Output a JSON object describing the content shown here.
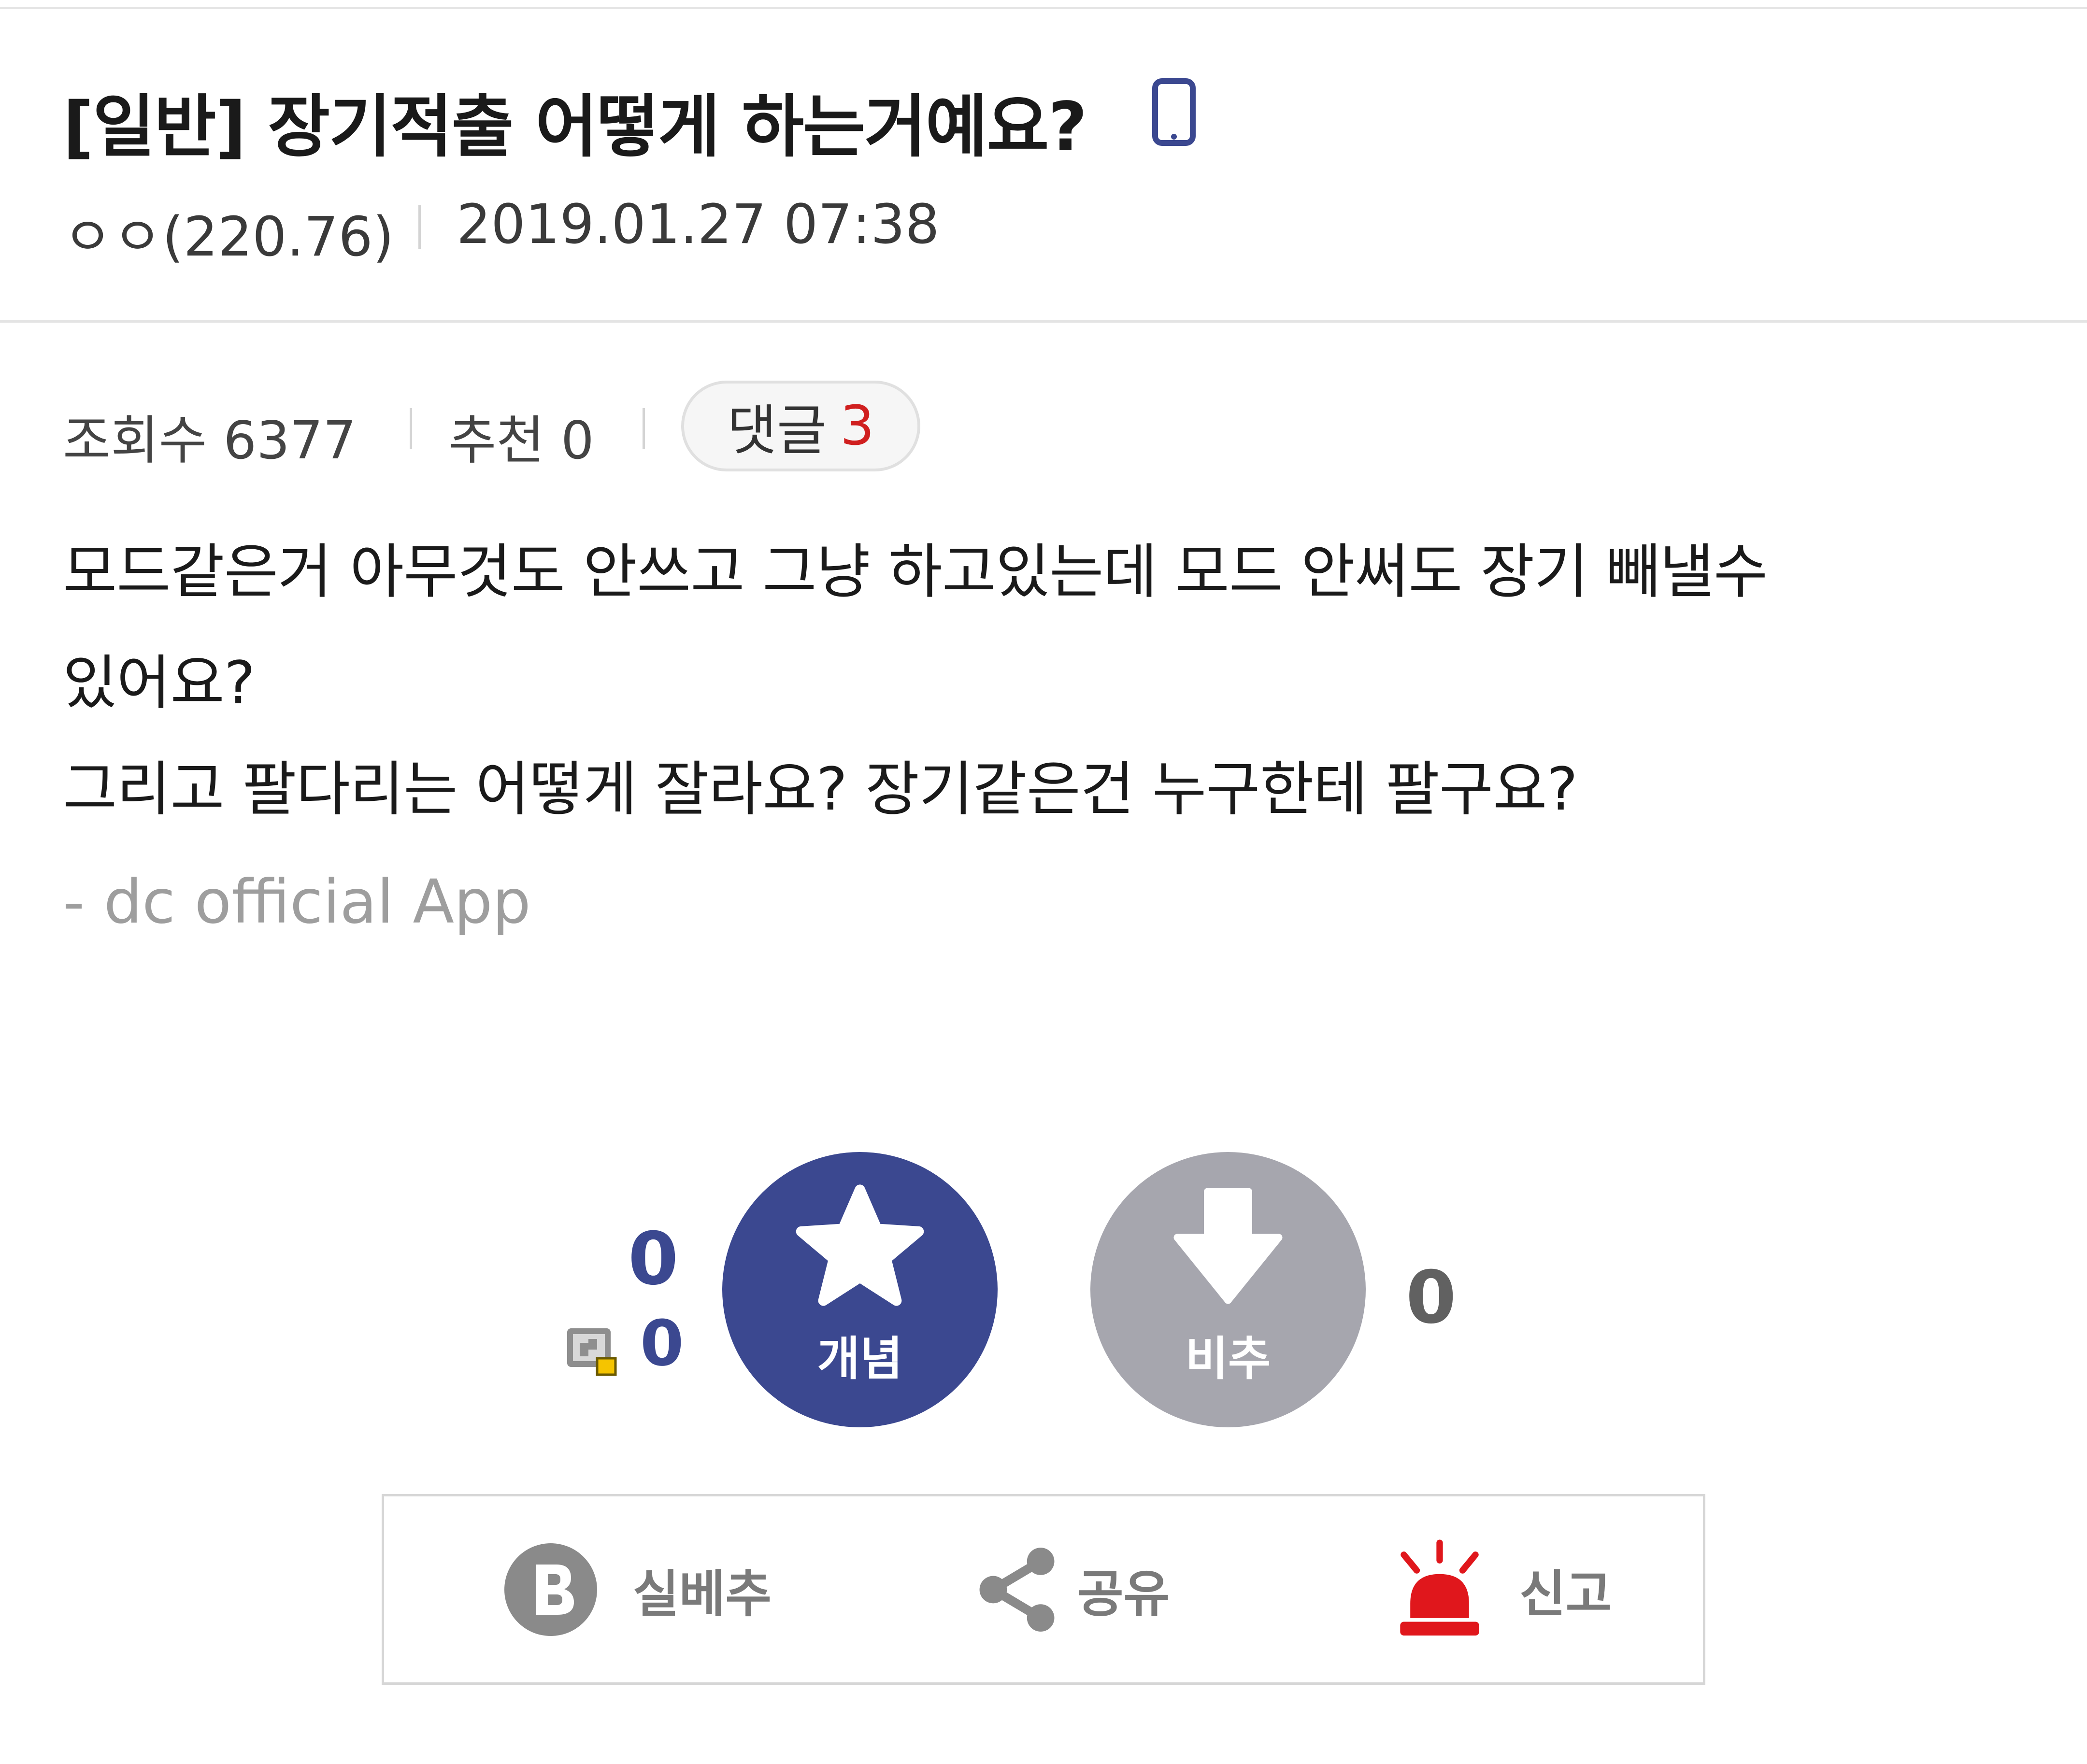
{
  "post": {
    "title": "[일반] 장기적출 어떻게 하는거예요?",
    "author": "ㅇㅇ(220.76)",
    "datetime": "2019.01.27 07:38"
  },
  "stats": {
    "views_label": "조회수 6377",
    "recommend_label": "추천 0",
    "comments_label": "댓글",
    "comments_count": "3"
  },
  "content": {
    "lines": [
      "모드같은거 아무것도 안쓰고 그냥 하고있는데 모드 안써도 장기 빼낼수",
      "있어요?",
      "그리고 팔다리는 어떻게 잘라요? 장기같은건 누구한테 팔구요?"
    ],
    "signature": "- dc official App"
  },
  "votes": {
    "up_count": "0",
    "fixed_nick_up_count": "0",
    "up_label": "개념",
    "down_label": "비추",
    "down_count": "0"
  },
  "actions": {
    "best_label": "실베추",
    "share_label": "공유",
    "report_label": "신고"
  },
  "colors": {
    "up_button": "#3b4890",
    "down_button": "#a6a6ae",
    "comment_count": "#d01f1f",
    "report_icon": "#e0171c"
  },
  "icons": [
    "mobile-icon",
    "star-icon",
    "arrow-down-icon",
    "fixed-nick-icon",
    "b-badge-icon",
    "share-icon",
    "siren-icon"
  ]
}
